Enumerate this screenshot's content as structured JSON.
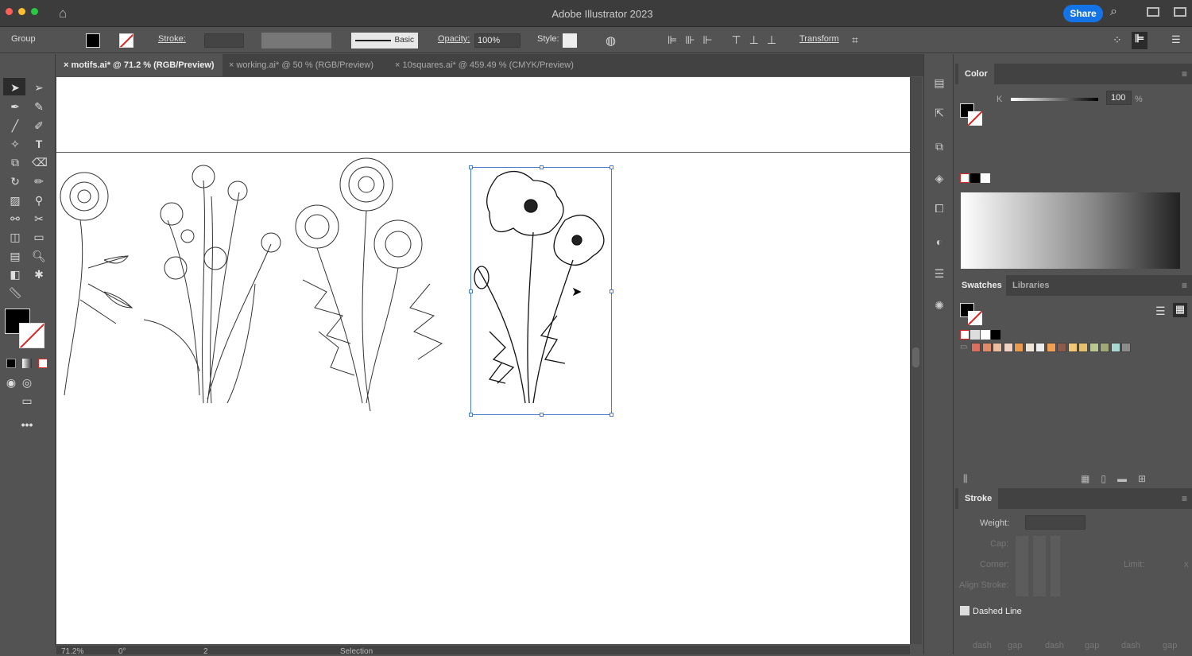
{
  "window": {
    "title": "Adobe Illustrator 2023",
    "share": "Share"
  },
  "control": {
    "selection": "Group",
    "stroke_label": "Stroke:",
    "brush": "Basic",
    "opacity_label": "Opacity:",
    "opacity_value": "100%",
    "style_label": "Style:",
    "transform": "Transform"
  },
  "tabs": [
    {
      "label": "motifs.ai* @ 71.2 % (RGB/Preview)",
      "active": true
    },
    {
      "label": "working.ai* @ 50 % (RGB/Preview)"
    },
    {
      "label": "10squares.ai* @ 459.49 % (CMYK/Preview)"
    }
  ],
  "color_panel": {
    "title": "Color",
    "channel": "K",
    "value": "100",
    "unit": "%"
  },
  "swatches_panel": {
    "tabs": [
      "Swatches",
      "Libraries"
    ],
    "colors": [
      "#d9705f",
      "#e08a6c",
      "#ebbc9e",
      "#efd2c4",
      "#e89a4e",
      "#ece4d6",
      "#ececec",
      "#f0a050",
      "#8a5a4a",
      "#f2c878",
      "#e6c070",
      "#b8c890",
      "#a0a878",
      "#a8d8d0",
      "#8c8c8c"
    ]
  },
  "stroke_panel": {
    "title": "Stroke",
    "weight": "Weight:",
    "cap": "Cap:",
    "corner": "Corner:",
    "limit": "Limit:",
    "limit_unit": "x",
    "align": "Align Stroke:",
    "dashed": "Dashed Line",
    "dash_labels": [
      "dash",
      "gap",
      "dash",
      "gap",
      "dash",
      "gap"
    ]
  },
  "status": {
    "zoom": "71.2%",
    "rotation": "0°",
    "artboard": "2",
    "tool": "Selection"
  }
}
